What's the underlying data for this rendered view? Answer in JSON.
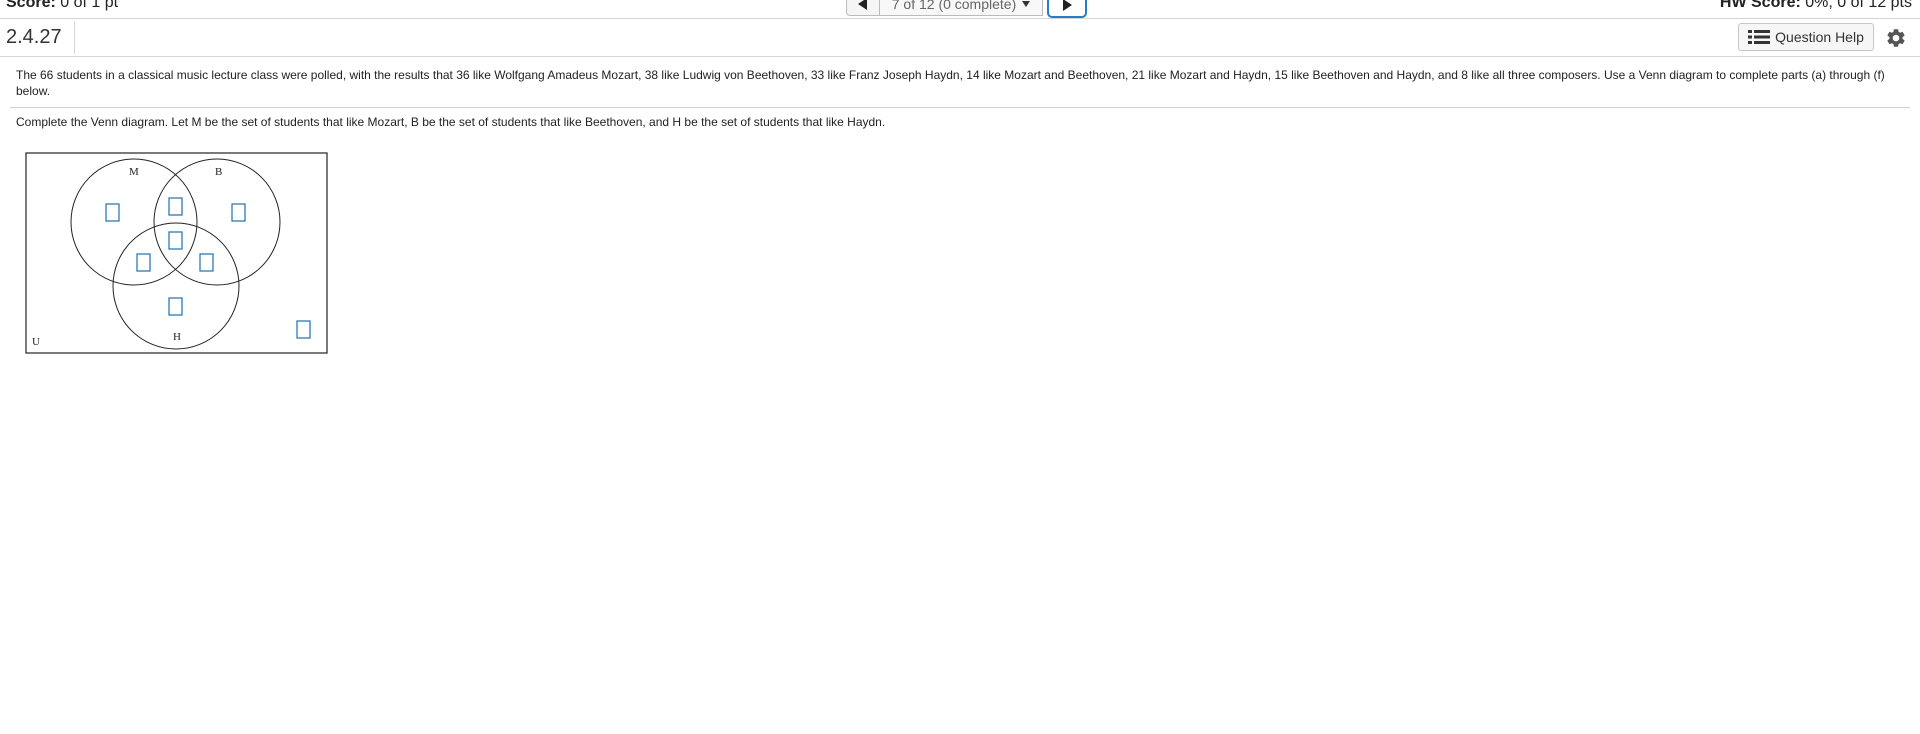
{
  "header": {
    "score_label": "Score:",
    "score_value": "0 of 1 pt",
    "nav_position": "7 of 12 (0 complete)",
    "hw_score_label": "HW Score:",
    "hw_score_value": "0%, 0 of 12 pts"
  },
  "question": {
    "number": "2.4.27",
    "help_label": "Question Help",
    "problem_text": "The 66 students in a classical music lecture class were polled, with the results that 36 like Wolfgang Amadeus Mozart, 38 like Ludwig von Beethoven, 33 like Franz Joseph Haydn, 14 like Mozart and Beethoven, 21 like Mozart and Haydn, 15 like Beethoven and Haydn, and 8 like all three composers. Use a Venn diagram to complete parts (a) through (f) below.",
    "instruction": "Complete the Venn diagram. Let M be the set of students that like Mozart, B be the set of students that like Beethoven, and H be the set of students that like Haydn."
  },
  "venn": {
    "label_M": "M",
    "label_B": "B",
    "label_H": "H",
    "label_U": "U",
    "answer_box_color": "#1b6fb0"
  },
  "icons": {
    "prev": "triangle-left-icon",
    "next": "triangle-right-icon",
    "dropdown": "caret-down-icon",
    "help": "list-icon",
    "settings": "gear-icon"
  }
}
